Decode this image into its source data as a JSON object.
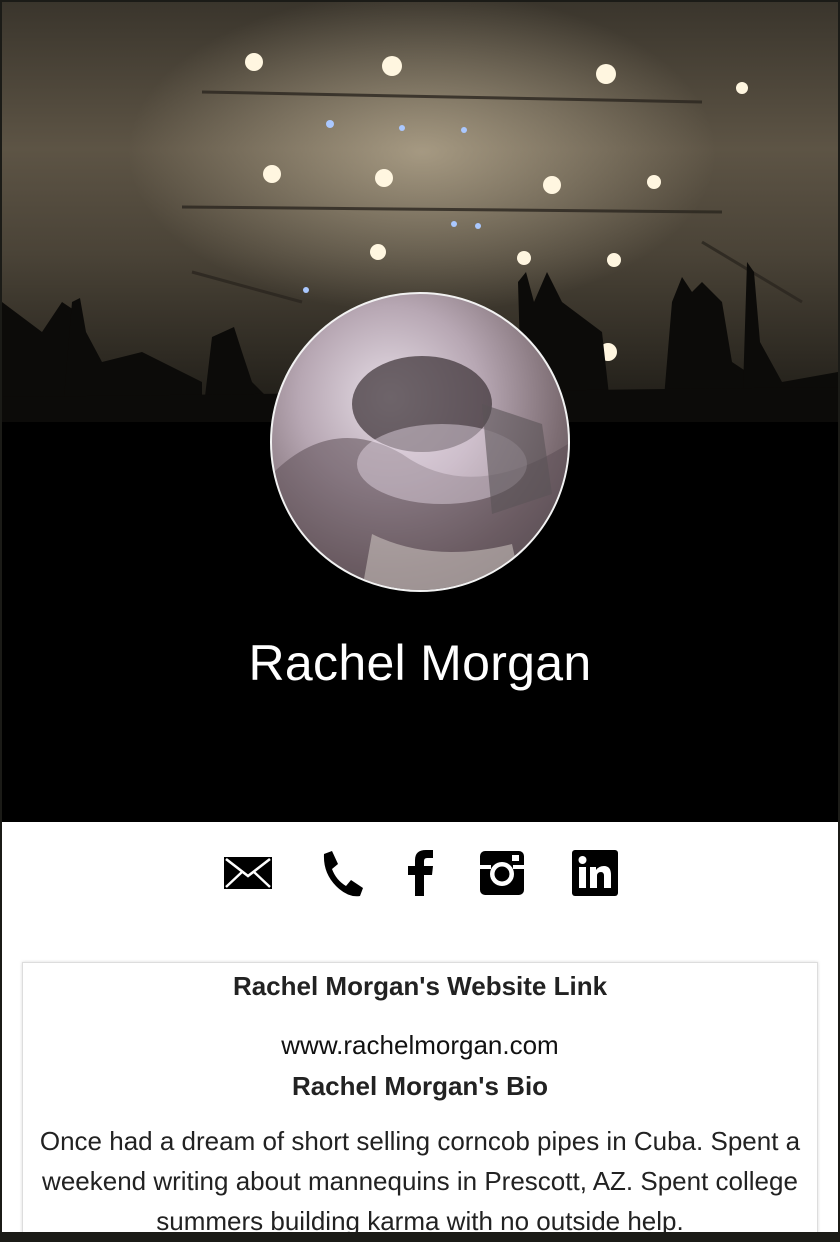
{
  "profile": {
    "name": "Rachel Morgan"
  },
  "contact_icons": [
    {
      "name": "email",
      "icon": "envelope-icon"
    },
    {
      "name": "phone",
      "icon": "phone-icon"
    },
    {
      "name": "facebook",
      "icon": "facebook-icon"
    },
    {
      "name": "instagram",
      "icon": "instagram-icon"
    },
    {
      "name": "linkedin",
      "icon": "linkedin-icon"
    }
  ],
  "website": {
    "heading": "Rachel Morgan's Website Link",
    "url": "www.rachelmorgan.com"
  },
  "bio": {
    "heading": "Rachel Morgan's Bio",
    "text": "Once had a dream of short selling corncob pipes in Cuba. Spent a weekend writing about mannequins in Prescott, AZ. Spent college summers building karma with no outside help."
  },
  "colors": {
    "banner_bottom": "#000000",
    "icon": "#000000",
    "text": "#222222"
  }
}
